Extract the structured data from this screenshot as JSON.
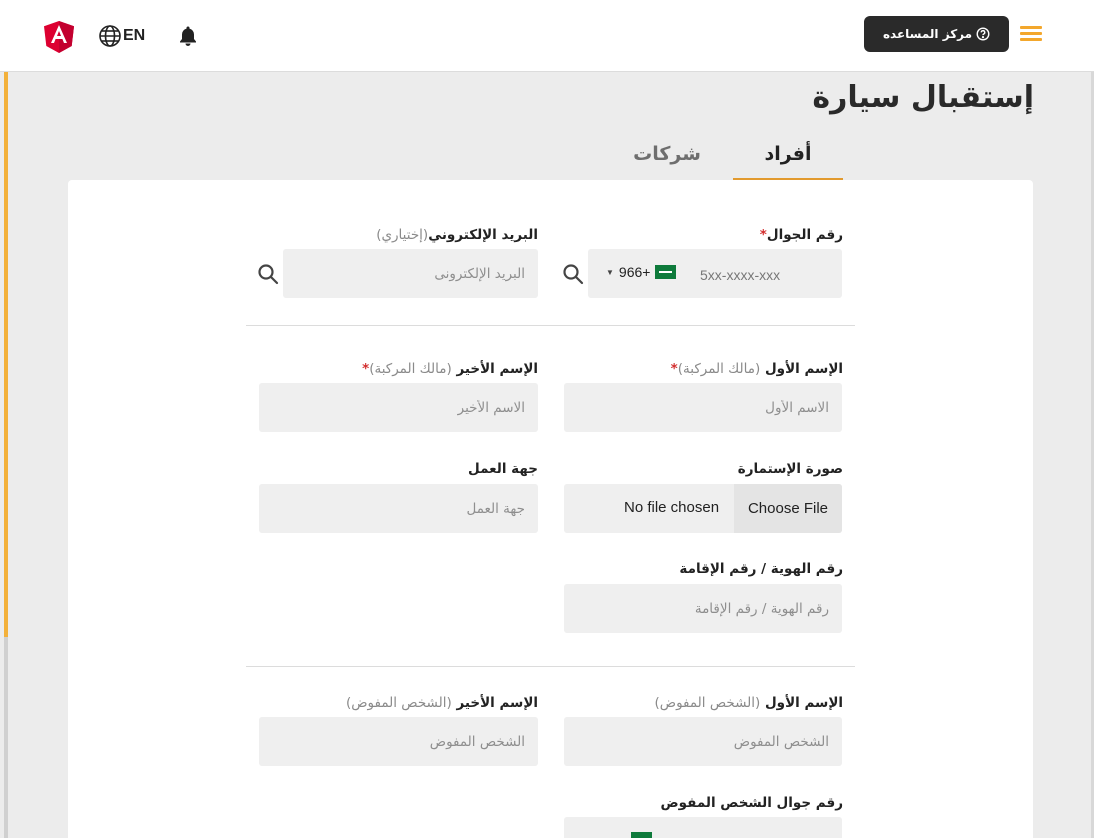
{
  "header": {
    "logo_icon": "angular-logo-icon",
    "language_label": "EN",
    "help_label": "مركز المساعده",
    "colors": {
      "accent": "#f3a72c",
      "dark_button": "#2a2a2a",
      "tab_underline": "#e29a2e"
    }
  },
  "page": {
    "title": "إستقبال سيارة",
    "tabs": [
      {
        "label": "أفراد",
        "active": true
      },
      {
        "label": "شركات",
        "active": false
      }
    ]
  },
  "form": {
    "mobile": {
      "label": "رقم الجوال",
      "required_mark": "*",
      "country_code": "966+",
      "placeholder": "5xx-xxxx-xxx"
    },
    "email": {
      "label": "البريد الإلكتروني",
      "optional_note": "(إختياري)",
      "placeholder": "البريد الإلكترونى"
    },
    "owner_first_name": {
      "label": "الإسم الأول",
      "note": "(مالك المركبة)",
      "required_mark": "*",
      "placeholder": "الاسم الأول"
    },
    "owner_last_name": {
      "label": "الإسم الأخير",
      "note": "(مالك المركبة)",
      "required_mark": "*",
      "placeholder": "الاسم الأخير"
    },
    "registration_image": {
      "label": "صورة الإستمارة",
      "button_label": "Choose File",
      "file_status": "No file chosen"
    },
    "employer": {
      "label": "جهة العمل",
      "placeholder": "جهة العمل"
    },
    "id_number": {
      "label": "رقم الهوية / رقم الإقامة",
      "placeholder": "رقم الهوية / رقم الإقامة"
    },
    "delegate_first_name": {
      "label": "الإسم الأول",
      "note": "(الشخص المفوض)",
      "placeholder": "الشخص المفوض"
    },
    "delegate_last_name": {
      "label": "الإسم الأخير",
      "note": "(الشخص المفوض)",
      "placeholder": "الشخص المفوض"
    },
    "delegate_mobile": {
      "label": "رقم جوال الشخص المفوض"
    }
  }
}
